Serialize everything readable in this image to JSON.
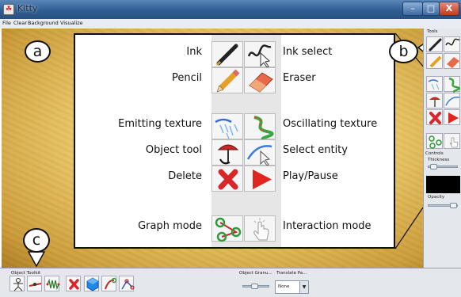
{
  "window": {
    "title": "Kitty"
  },
  "menubar": {
    "items": [
      "File",
      "Clear",
      "Background",
      "Visualize"
    ]
  },
  "callouts": {
    "a": "a",
    "b": "b",
    "c": "c"
  },
  "legend": {
    "left": [
      "Ink",
      "Pencil",
      "Emitting texture",
      "Object tool",
      "Delete",
      "Graph mode"
    ],
    "right": [
      "Ink select",
      "Eraser",
      "Oscillating texture",
      "Select entity",
      "Play/Pause",
      "Interaction mode"
    ]
  },
  "toolpanel": {
    "tools_label": "Tools",
    "controls_label": "Controls",
    "thickness_label": "Thickness",
    "opacity_label": "Opacity",
    "thickness_level": 0.1,
    "opacity_level": 0.95,
    "color": "#000000"
  },
  "bottom": {
    "toolkit_label": "Object Toolkit",
    "granularity_label": "Object Granu...",
    "translate_label": "Translate Pa...",
    "translate_value": "None",
    "granularity_level": 0.45
  },
  "colors": {
    "accent": "#2f5d92",
    "delete": "#d9262b",
    "play": "#e0261f",
    "canvas": "#ebc86a"
  }
}
